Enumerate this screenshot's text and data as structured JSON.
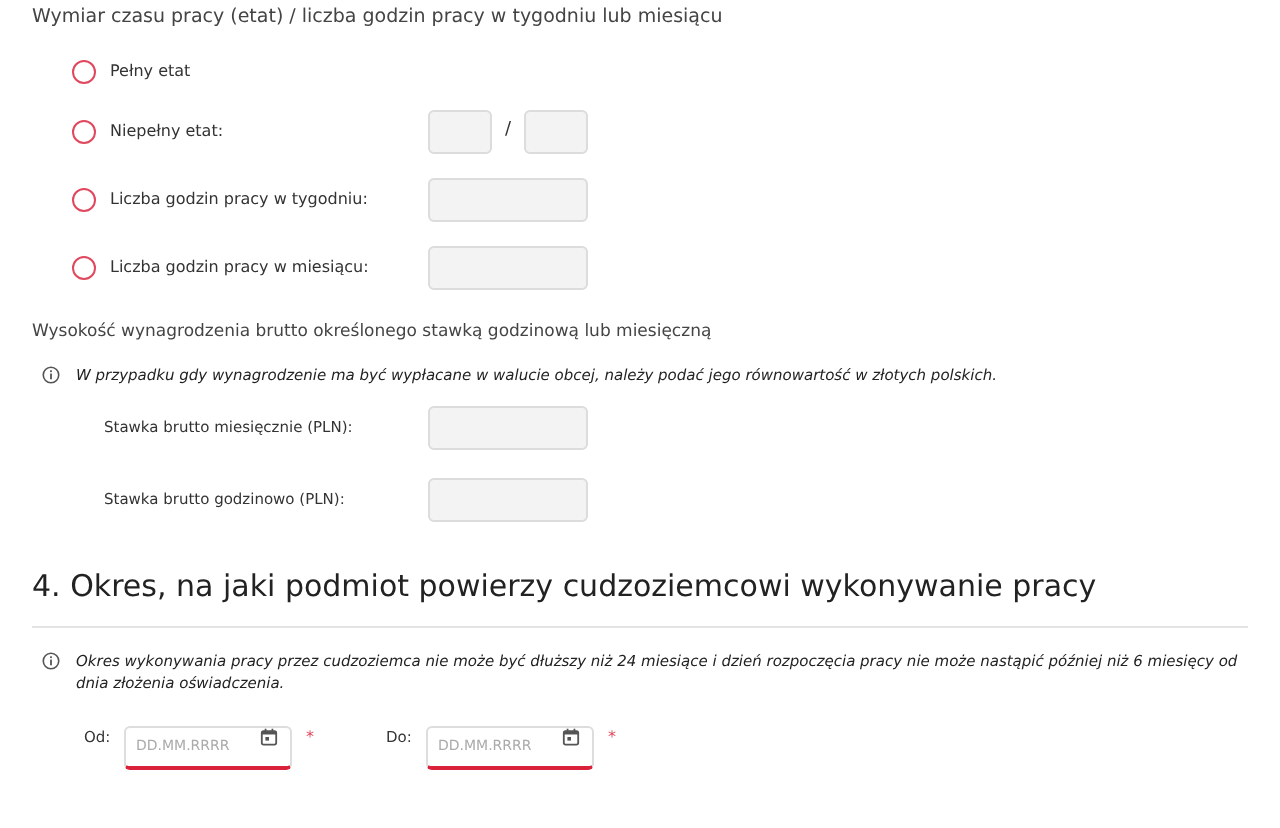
{
  "working_time": {
    "title": "Wymiar czasu pracy (etat) / liczba godzin pracy w tygodniu lub miesiącu",
    "options": [
      {
        "kind": "none",
        "label": "Pełny etat",
        "selected": false
      },
      {
        "kind": "fraction",
        "label": "Niepełny etat:",
        "separator": "/",
        "selected": false
      },
      {
        "kind": "field",
        "label": "Liczba godzin pracy w tygodniu:",
        "selected": false
      },
      {
        "kind": "field",
        "label": "Liczba godzin pracy w miesiącu:",
        "selected": false
      }
    ]
  },
  "salary": {
    "title": "Wysokość wynagrodzenia brutto określonego stawką godzinową lub miesięczną",
    "info": "W przypadku gdy wynagrodzenie ma być wypłacane w walucie obcej, należy podać jego równowartość w złotych polskich.",
    "fields": [
      {
        "label": "Stawka brutto miesięcznie (PLN):"
      },
      {
        "label": "Stawka brutto godzinowo (PLN):"
      }
    ]
  },
  "section_4": {
    "title": "4. Okres, na jaki podmiot powierzy cudzoziemcowi wykonywanie pracy",
    "info": "Okres wykonywania pracy przez cudzoziemca nie może być dłuższy niż 24 miesiące i dzień rozpoczęcia pracy nie może nastąpić później niż 6 miesięcy od dnia złożenia oświadczenia.",
    "dates": [
      {
        "label": "Od:",
        "placeholder": "DD.MM.RRRR",
        "required_mark": "*"
      },
      {
        "label": "Do:",
        "placeholder": "DD.MM.RRRR",
        "required_mark": "*"
      }
    ]
  }
}
